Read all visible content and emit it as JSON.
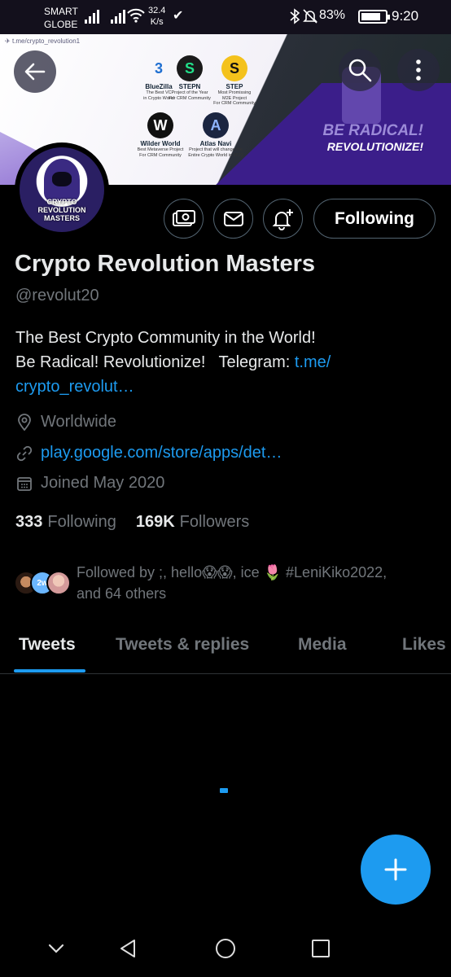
{
  "status_bar": {
    "carrier_line1": "SMART",
    "carrier_line2": "GLOBE",
    "speed_value": "32.4",
    "speed_unit": "K/s",
    "battery_percent": "83%",
    "battery_level": 0.83,
    "time": "9:20"
  },
  "banner": {
    "telegram_link": "t.me/crypto_revolution1",
    "tiles": [
      {
        "name": "BlueZilla",
        "sub1": "The Best VC",
        "sub2": "in Crypto World",
        "color": "#1f6fd1",
        "glyph": "3"
      },
      {
        "name": "STEPN",
        "sub1": "Project of the Year",
        "sub2": "For CRM Community",
        "color": "#22b36b",
        "glyph": "S"
      },
      {
        "name": "STEP",
        "sub1": "Most Promissing",
        "sub2": "M2E Project",
        "sub3": "For CRM Community",
        "color": "#f4c21c",
        "glyph": "S"
      },
      {
        "name": "Wilder World",
        "sub1": "Best Metaverse Project",
        "sub2": "For CRM Community",
        "color": "#111111",
        "glyph": "W"
      },
      {
        "name": "Atlas Navi",
        "sub1": "Project that will change the",
        "sub2": "Entire Crypto World in 2022",
        "color": "#1b2541",
        "glyph": "A"
      }
    ],
    "slogan1": "BE RADICAL!",
    "slogan2": "REVOLUTIONIZE!"
  },
  "avatar": {
    "line1": "CRYPTO",
    "line2": "REVOLUTION",
    "line3": "MASTERS"
  },
  "profile": {
    "follow_state": "Following",
    "name": "Crypto Revolution Masters",
    "handle": "@revolut20",
    "bio_line1": "The Best Crypto Community in the World!",
    "bio_line2_a": "Be Radical! Revolutionize!",
    "bio_line2_b": "Telegram:",
    "bio_link_part1": "t.me/",
    "bio_link_part2": "crypto_revolut…",
    "location": "Worldwide",
    "website": "play.google.com/store/apps/det…",
    "joined": "Joined May 2020",
    "following_count": "333",
    "following_label": "Following",
    "followers_count": "169K",
    "followers_label": "Followers",
    "followed_by_line1": "Followed by ;, hello😱😱, ice 🌷 #LeniKiko2022,",
    "followed_by_line2": "and 64 others",
    "mini_avatar_3_text": "2w"
  },
  "tabs": [
    "Tweets",
    "Tweets & replies",
    "Media",
    "Likes"
  ],
  "colors": {
    "accent": "#1d9bf0",
    "background": "#000000",
    "muted": "#71767b"
  }
}
